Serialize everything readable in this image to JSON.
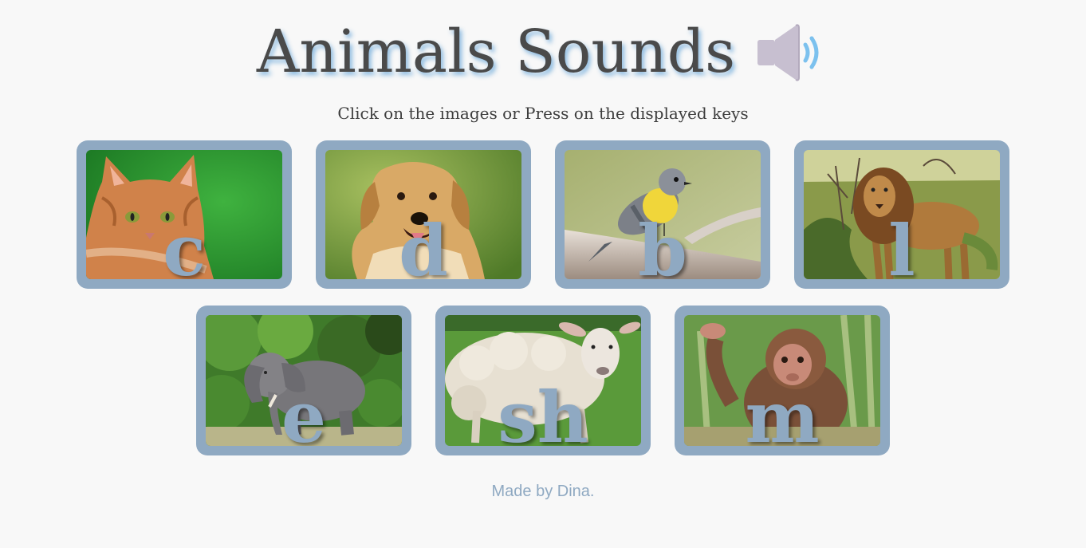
{
  "header": {
    "title": "Animals Sounds",
    "icon": "speaker-icon"
  },
  "subtitle": "Click on the images or Press on the displayed keys",
  "cards": [
    {
      "animal": "cat",
      "key": "c",
      "icon": "cat-image"
    },
    {
      "animal": "dog",
      "key": "d",
      "icon": "dog-image"
    },
    {
      "animal": "bird",
      "key": "b",
      "icon": "bird-image"
    },
    {
      "animal": "lion",
      "key": "l",
      "icon": "lion-image"
    },
    {
      "animal": "elephant",
      "key": "e",
      "icon": "elephant-image"
    },
    {
      "animal": "sheep",
      "key": "sh",
      "icon": "sheep-image"
    },
    {
      "animal": "monkey",
      "key": "m",
      "icon": "monkey-image"
    }
  ],
  "footer": "Made by Dina.",
  "colors": {
    "card_border": "#8fa9c2",
    "title_text": "#4a4a4a",
    "title_glow": "#78afdc",
    "background": "#f8f8f8"
  }
}
